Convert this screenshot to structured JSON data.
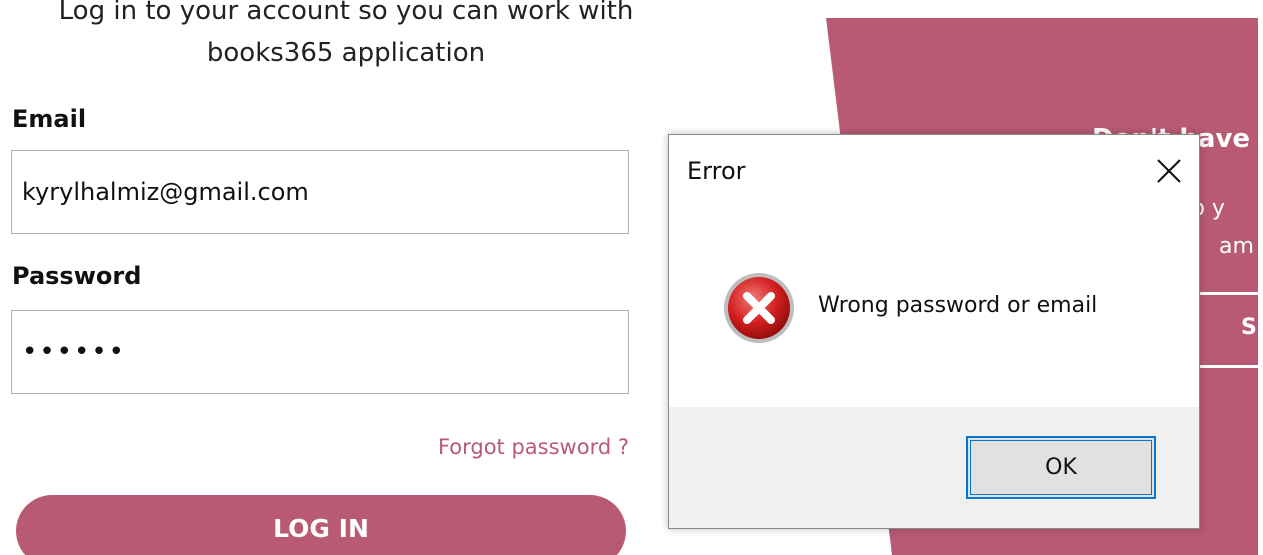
{
  "login": {
    "subtitle_line1": "Log in to your account so you can work with",
    "subtitle_line2": "books365 application",
    "email_label": "Email",
    "email_value": "kyrylhalmiz@gmail.com",
    "password_label": "Password",
    "password_value": "••••••",
    "forgot_link": "Forgot password ?",
    "login_button": "LOG IN"
  },
  "side_panel": {
    "heading": "Don't have",
    "line1": "so y",
    "line2": "am",
    "button_label": "S"
  },
  "dialog": {
    "title": "Error",
    "message": "Wrong password or email",
    "ok_button": "OK",
    "icon": "error-icon"
  },
  "colors": {
    "accent": "#b95a75",
    "dialog_footer": "#f0f0f0",
    "focus": "#0078d7"
  }
}
